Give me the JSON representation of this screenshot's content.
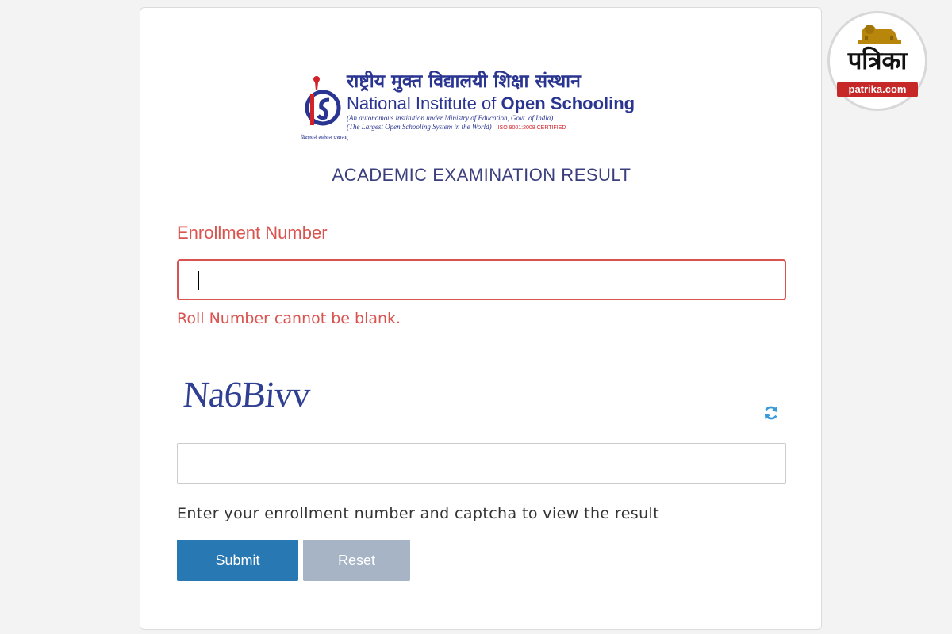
{
  "logo": {
    "hindi_name": "राष्ट्रीय मुक्त विद्यालयी शिक्षा संस्थान",
    "english_name_regular": "National Institute of ",
    "english_name_bold": "Open Schooling",
    "tagline_1": "(An autonomous institution under Ministry of Education, Govt. of India)",
    "tagline_2": "(The Largest Open Schooling System in the World)",
    "iso": "ISO 9001:2008 CERTIFIED",
    "emblem_caption": "विद्याधनं सर्वधन प्रधानम्"
  },
  "page_title": "ACADEMIC EXAMINATION RESULT",
  "form": {
    "enrollment_label": "Enrollment Number",
    "enrollment_value": "",
    "error_message": "Roll Number cannot be blank.",
    "captcha_text": "Na6Bivv",
    "captcha_value": "",
    "help_text": "Enter your enrollment number and captcha to view the result",
    "submit_label": "Submit",
    "reset_label": "Reset"
  },
  "watermark": {
    "brand_hindi": "पत्रिका",
    "domain": "patrika.com"
  },
  "icons": {
    "refresh": "refresh-icon",
    "lion": "lion-icon"
  },
  "colors": {
    "error": "#d9534f",
    "primary": "#2878b4",
    "reset": "#a6b4c6",
    "brand_blue": "#2a3591",
    "patrika_red": "#c62828"
  }
}
